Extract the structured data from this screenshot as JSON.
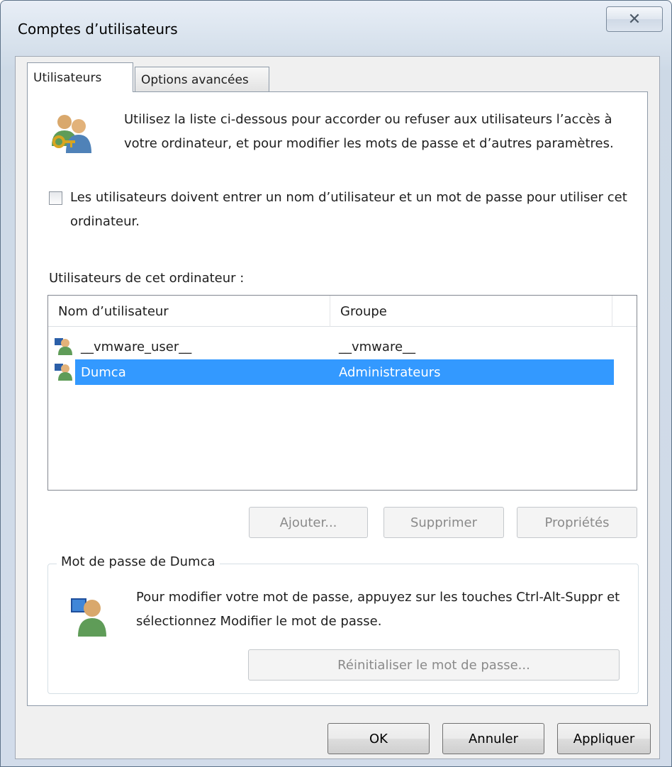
{
  "window": {
    "title": "Comptes d’utilisateurs",
    "close_glyph": "✕"
  },
  "tabs": [
    {
      "label": "Utilisateurs",
      "active": true
    },
    {
      "label": "Options avancées",
      "active": false
    }
  ],
  "intro": {
    "icon": "users-key-icon",
    "text": "Utilisez la liste ci-dessous pour accorder ou refuser aux utilisateurs l’accès à votre ordinateur, et pour modifier les mots de passe et d’autres paramètres."
  },
  "require_login": {
    "checked": false,
    "label": "Les utilisateurs doivent entrer un nom d’utilisateur et un mot de passe pour utiliser cet ordinateur."
  },
  "users_list": {
    "caption": "Utilisateurs de cet ordinateur :",
    "columns": [
      "Nom d’utilisateur",
      "Groupe"
    ],
    "rows": [
      {
        "name": "__vmware_user__",
        "group": "__vmware__",
        "selected": false
      },
      {
        "name": "Dumca",
        "group": "Administrateurs",
        "selected": true
      }
    ]
  },
  "list_buttons": {
    "add": "Ajouter...",
    "remove": "Supprimer",
    "properties": "Propriétés"
  },
  "password_group": {
    "title": "Mot de passe de Dumca",
    "text": "Pour modifier votre mot de passe, appuyez sur les touches Ctrl-Alt-Suppr et sélectionnez Modifier le mot de passe.",
    "reset_button": "Réinitialiser le mot de passe..."
  },
  "footer": {
    "ok": "OK",
    "cancel": "Annuler",
    "apply": "Appliquer"
  },
  "colors": {
    "selection": "#3399ff",
    "window_frame": "#cdd9e6"
  }
}
